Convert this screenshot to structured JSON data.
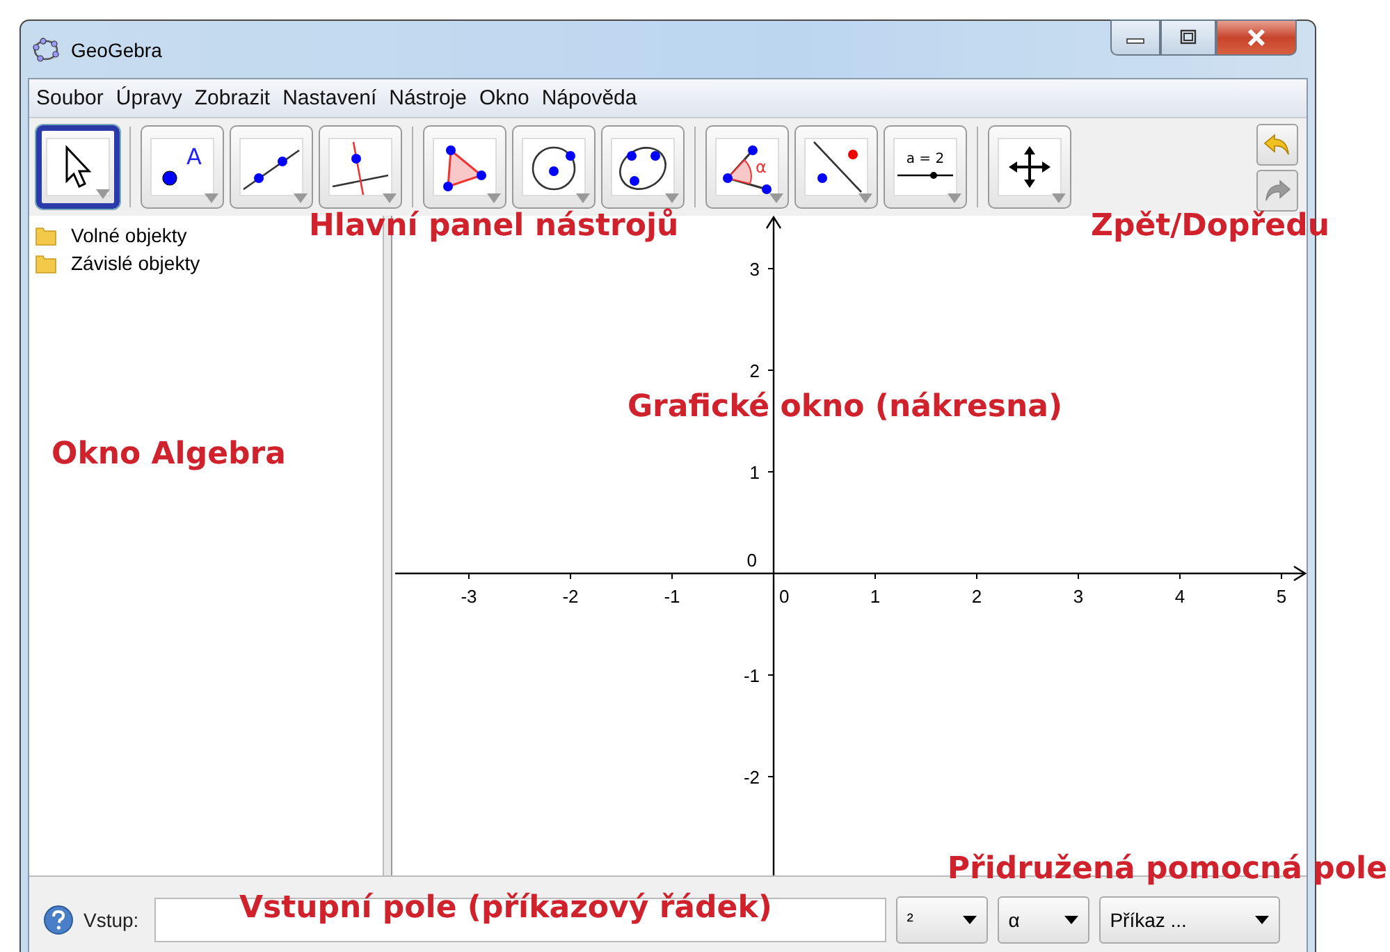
{
  "window": {
    "title": "GeoGebra"
  },
  "menu": [
    "Soubor",
    "Úpravy",
    "Zobrazit",
    "Nastavení",
    "Nástroje",
    "Okno",
    "Nápověda"
  ],
  "tool_groups": [
    {
      "tools": [
        {
          "kind": "move",
          "selected": true
        }
      ]
    },
    {
      "tools": [
        {
          "kind": "point",
          "label": "A",
          "selected": false
        },
        {
          "kind": "line",
          "selected": false
        },
        {
          "kind": "perpendicular",
          "selected": false
        }
      ]
    },
    {
      "tools": [
        {
          "kind": "polygon",
          "selected": false
        },
        {
          "kind": "circle",
          "selected": false
        },
        {
          "kind": "conic",
          "selected": false
        }
      ]
    },
    {
      "tools": [
        {
          "kind": "angle",
          "label": "α",
          "selected": false
        },
        {
          "kind": "reflect",
          "selected": false
        },
        {
          "kind": "slider",
          "label": "a = 2",
          "selected": false
        }
      ]
    },
    {
      "tools": [
        {
          "kind": "move-view",
          "selected": false
        }
      ]
    }
  ],
  "history": [
    {
      "kind": "undo",
      "disabled": false
    },
    {
      "kind": "redo",
      "disabled": true
    }
  ],
  "algebra": {
    "folders": [
      "Volné objekty",
      "Závislé objekty"
    ]
  },
  "graphics": {
    "x_negative": [
      "-3",
      "-2",
      "-1"
    ],
    "x_positive": [
      "1",
      "2",
      "3",
      "4",
      "5"
    ],
    "y_positive": [
      "3",
      "2",
      "1"
    ],
    "y_negative": [
      "-1",
      "-2"
    ],
    "origin_x_label": "0",
    "origin_y_label": "0"
  },
  "input_bar": {
    "label": "Vstup:",
    "dropdowns": [
      {
        "kind": "small",
        "value": "²"
      },
      {
        "kind": "small",
        "value": "α"
      },
      {
        "kind": "wide",
        "value": "Příkaz ..."
      }
    ]
  },
  "annotations": [
    {
      "kind": "toolbar",
      "text": "Hlavní panel nástrojů"
    },
    {
      "kind": "history",
      "text": "Zpět/Dopředu"
    },
    {
      "kind": "graphics",
      "text": "Grafické okno (nákresna)"
    },
    {
      "kind": "algebra",
      "text": "Okno Algebra"
    },
    {
      "kind": "fields",
      "text": "Přidružená pomocná pole"
    },
    {
      "kind": "input",
      "text": "Vstupní pole (příkazový řádek)"
    }
  ]
}
